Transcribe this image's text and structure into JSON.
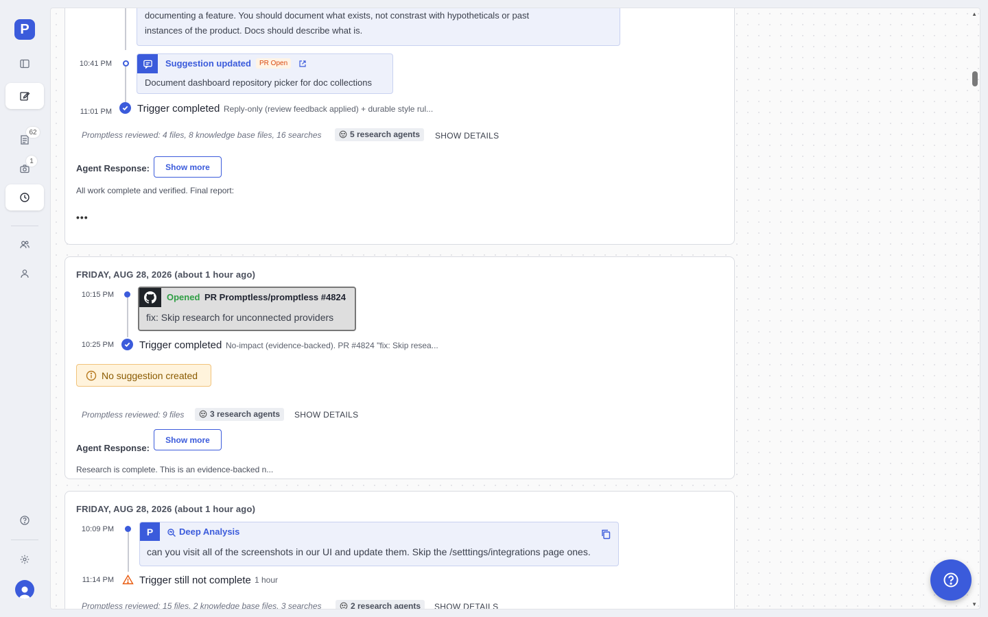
{
  "sidebar": {
    "logo_letter": "P",
    "suggestions_badge": "62",
    "screenshots_badge": "1"
  },
  "card1": {
    "quote_line1": "documenting a feature. You should document what exists, not constrast with hypotheticals or past",
    "quote_line2": "instances of the product. Docs should describe what is.",
    "event1": {
      "time": "10:41 PM",
      "title": "Suggestion updated",
      "pill": "PR Open",
      "body": "Document dashboard repository picker for doc collections"
    },
    "trigger": {
      "time": "11:01 PM",
      "title": "Trigger completed",
      "desc": "Reply-only (review feedback applied) + durable style rul..."
    },
    "reviewed": "Promptless reviewed: 4 files, 8 knowledge base files, 16 searches",
    "agents": "5 research agents",
    "show_details": "SHOW DETAILS",
    "agent_label": "Agent Response:",
    "show_more": "Show more",
    "response": "All work complete and verified. Final report:",
    "ellipsis": "•••"
  },
  "card2": {
    "date": "FRIDAY, AUG 28, 2026 (about 1 hour ago)",
    "event1": {
      "time": "10:15 PM",
      "opened": "Opened",
      "pr": "PR Promptless/promptless #4824",
      "body": "fix: Skip research for unconnected providers"
    },
    "trigger": {
      "time": "10:25 PM",
      "title": "Trigger completed",
      "desc": "No-impact (evidence-backed). PR #4824 \"fix: Skip resea..."
    },
    "no_suggestion": "No suggestion created",
    "reviewed": "Promptless reviewed: 9 files",
    "agents": "3 research agents",
    "show_details": "SHOW DETAILS",
    "agent_label": "Agent Response:",
    "show_more": "Show more",
    "response": "Research is complete. This is an evidence-backed n..."
  },
  "card3": {
    "date": "FRIDAY, AUG 28, 2026 (about 1 hour ago)",
    "event1": {
      "time": "10:09 PM",
      "title": "Deep Analysis",
      "body": "can you visit all of the screenshots in our UI and update them. Skip the /setttings/integrations page ones."
    },
    "trigger": {
      "time": "11:14 PM",
      "title": "Trigger still not complete",
      "desc": "1 hour"
    },
    "reviewed": "Promptless reviewed: 15 files, 2 knowledge base files, 3 searches",
    "agents": "2 research agents",
    "show_details": "SHOW DETAILS"
  },
  "colors": {
    "accent": "#3b5bdb",
    "success": "#2f9e44",
    "warning": "#d9480f"
  }
}
